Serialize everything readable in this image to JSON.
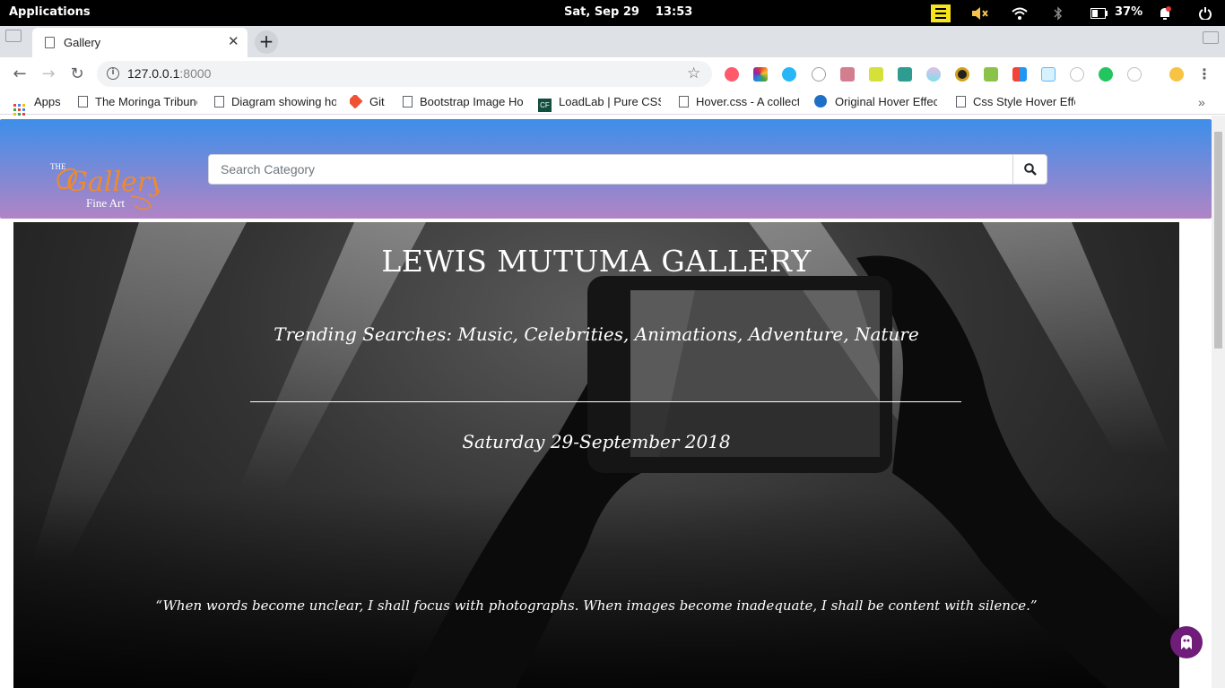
{
  "os": {
    "applications_label": "Applications",
    "date": "Sat, Sep 29",
    "time": "13:53",
    "battery_percent": "37%",
    "icons": [
      "sticky-notes-icon",
      "volume-muted-icon",
      "wifi-icon",
      "bluetooth-icon",
      "battery-icon",
      "notifications-icon",
      "power-icon"
    ]
  },
  "browser": {
    "tab_title": "Gallery",
    "url_host": "127.0.0.1",
    "url_port": ":8000",
    "bookmarks": [
      {
        "label": "Apps",
        "icon": "apps-grid-icon"
      },
      {
        "label": "The Moringa Tribune",
        "icon": "page-icon"
      },
      {
        "label": "Diagram showing how",
        "icon": "page-icon"
      },
      {
        "label": "Git",
        "icon": "git-icon"
      },
      {
        "label": "Bootstrap Image Ho",
        "icon": "page-icon"
      },
      {
        "label": "LoadLab | Pure CSS",
        "icon": "codefactory-icon"
      },
      {
        "label": "Hover.css - A collect",
        "icon": "page-icon"
      },
      {
        "label": "Original Hover Effec",
        "icon": "codrops-icon"
      },
      {
        "label": "Css Style Hover Effe",
        "icon": "page-icon"
      }
    ]
  },
  "site": {
    "logo": {
      "line1": "THE",
      "line2": "Gallery",
      "line3": "Fine Art"
    },
    "search_placeholder": "Search Category",
    "hero": {
      "title": "LEWIS MUTUMA GALLERY",
      "trending": "Trending Searches: Music, Celebrities, Animations, Adventure, Nature",
      "date": "Saturday 29-September 2018",
      "quote": "“When words become unclear, I shall focus with photographs. When images become inadequate, I shall be content with silence.”"
    }
  },
  "colors": {
    "nav_top": "#3d8fea",
    "nav_bottom": "#b184c5",
    "logo_orange": "#f08a2a",
    "chat_purple": "#6f1d78"
  }
}
